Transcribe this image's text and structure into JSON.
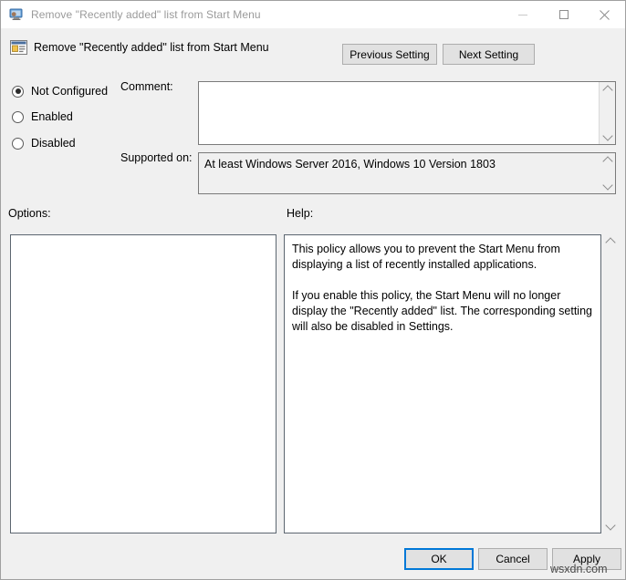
{
  "window": {
    "title": "Remove \"Recently added\" list from Start Menu",
    "icon": "policy-console-icon",
    "minimize_label": "Minimize",
    "maximize_label": "Maximize",
    "close_label": "Close"
  },
  "header": {
    "icon": "policy-setting-icon",
    "title": "Remove \"Recently added\" list from Start Menu",
    "previous_setting": "Previous Setting",
    "next_setting": "Next Setting"
  },
  "state": {
    "options": [
      {
        "label": "Not Configured",
        "checked": true
      },
      {
        "label": "Enabled",
        "checked": false
      },
      {
        "label": "Disabled",
        "checked": false
      }
    ]
  },
  "fields": {
    "comment_label": "Comment:",
    "comment_value": "",
    "supported_label": "Supported on:",
    "supported_value": "At least Windows Server 2016, Windows 10 Version 1803"
  },
  "panels": {
    "options_label": "Options:",
    "help_label": "Help:",
    "options_content": "",
    "help_paragraphs": [
      "This policy allows you to prevent the Start Menu from displaying a list of recently installed applications.",
      "If you enable this policy, the Start Menu will no longer display the \"Recently added\" list.  The corresponding setting will also be disabled in Settings."
    ]
  },
  "footer": {
    "ok": "OK",
    "cancel": "Cancel",
    "apply": "Apply"
  },
  "watermark": "wsxdn.com",
  "colors": {
    "dialog_background": "#f0f0f0",
    "focus_accent": "#0078d7",
    "title_text": "#9a9a9a",
    "panel_border": "#5c6670"
  }
}
